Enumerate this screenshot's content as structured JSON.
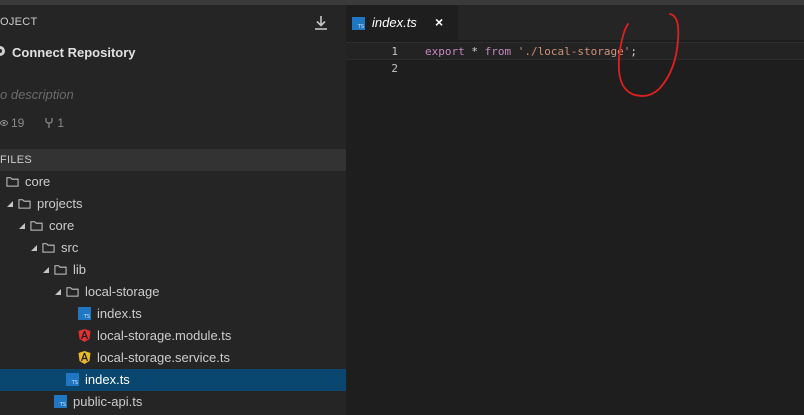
{
  "sidebar": {
    "project_title": "OJECT",
    "repo_label": "Connect Repository",
    "description": "o description",
    "watchers": "19",
    "forks": "1",
    "files_label": "FILES",
    "tree": [
      {
        "label": "core",
        "depth": 0,
        "kind": "folder",
        "expanded": false
      },
      {
        "label": "projects",
        "depth": 1,
        "kind": "folder",
        "expanded": true
      },
      {
        "label": "core",
        "depth": 2,
        "kind": "folder",
        "expanded": true
      },
      {
        "label": "src",
        "depth": 3,
        "kind": "folder",
        "expanded": true
      },
      {
        "label": "lib",
        "depth": 4,
        "kind": "folder",
        "expanded": true
      },
      {
        "label": "local-storage",
        "depth": 5,
        "kind": "folder",
        "expanded": true
      },
      {
        "label": "index.ts",
        "depth": 6,
        "kind": "ts"
      },
      {
        "label": "local-storage.module.ts",
        "depth": 6,
        "kind": "angular-red"
      },
      {
        "label": "local-storage.service.ts",
        "depth": 6,
        "kind": "angular-yellow"
      },
      {
        "label": "index.ts",
        "depth": 5,
        "kind": "ts",
        "selected": true
      },
      {
        "label": "public-api.ts",
        "depth": 4,
        "kind": "ts"
      }
    ]
  },
  "editor": {
    "tab_label": "index.ts",
    "tab_close": "×",
    "lines": [
      {
        "number": "1",
        "tokens": [
          {
            "t": "export",
            "c": "kw"
          },
          {
            "t": " * ",
            "c": ""
          },
          {
            "t": "from",
            "c": "kw"
          },
          {
            "t": " ",
            "c": ""
          },
          {
            "t": "'./local-storage'",
            "c": "str"
          },
          {
            "t": ";",
            "c": ""
          }
        ]
      },
      {
        "number": "2",
        "tokens": []
      }
    ]
  },
  "colors": {
    "selection": "#094771",
    "keyword": "#c586c0",
    "string": "#ce9178",
    "annotation": "#e02020"
  }
}
